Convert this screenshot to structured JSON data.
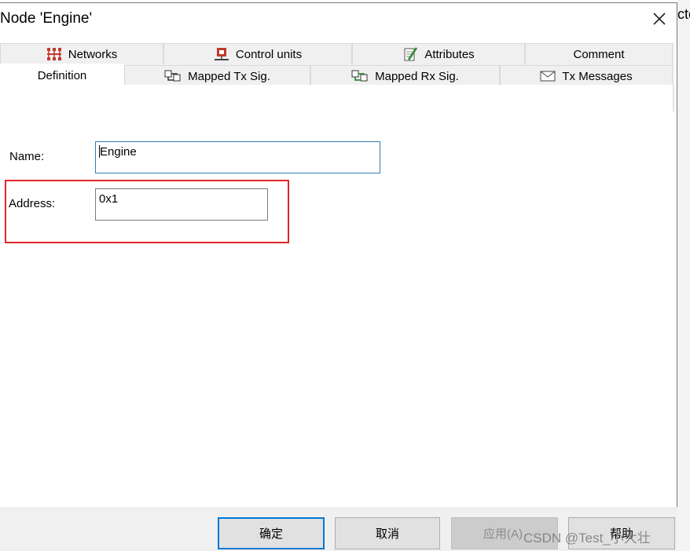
{
  "backdrop": {
    "text": "cto"
  },
  "dialog": {
    "title": "Node 'Engine'"
  },
  "tabs": {
    "row1": [
      {
        "label": "Networks",
        "icon": "network-icon"
      },
      {
        "label": "Control units",
        "icon": "control-unit-icon"
      },
      {
        "label": "Attributes",
        "icon": "attributes-icon"
      },
      {
        "label": "Comment",
        "icon": ""
      }
    ],
    "row2": [
      {
        "label": "Definition",
        "icon": "",
        "active": true
      },
      {
        "label": "Mapped Tx Sig.",
        "icon": "mapped-tx-icon"
      },
      {
        "label": "Mapped Rx Sig.",
        "icon": "mapped-rx-icon"
      },
      {
        "label": "Tx Messages",
        "icon": "envelope-icon"
      }
    ]
  },
  "form": {
    "name_label": "Name:",
    "name_value": "Engine",
    "address_label": "Address:",
    "address_value": "0x1"
  },
  "buttons": {
    "ok": "确定",
    "cancel": "取消",
    "apply": "应用(A)",
    "help": "帮助"
  },
  "watermark": "CSDN @Test_小大壮",
  "colors": {
    "highlight": "#e0262b",
    "focus_border": "#2f7fb3",
    "default_button_border": "#0078d7"
  }
}
